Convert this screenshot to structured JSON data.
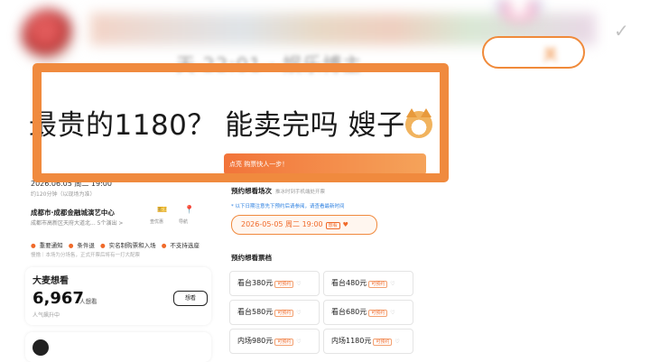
{
  "post": {
    "meta_text": "天 22:01 · 娱乐博主",
    "follow_label": "关",
    "title_text": "最贵的1180？ 能卖完吗 嫂子"
  },
  "left_panel": {
    "date": "2026.06.05 周二 19:00",
    "duration": "约120分钟（以现场为准）",
    "venue": "成都市·成都金融城演艺中心",
    "address": "成都市高新区天府大道北...  5个演出 >",
    "icon_labels": [
      "查优惠",
      "导航"
    ],
    "tags": [
      "重要通知",
      "条件退",
      "实名制购票和入场",
      "不支持选座"
    ],
    "tag_note": "慢撸｜本场为分场售，正式开票后将有一打大配票",
    "want": {
      "title": "大麦想看",
      "count": "6,967",
      "unit": "人想看",
      "sub": "人气飙升中",
      "button_label": "想看"
    }
  },
  "right_panel": {
    "banner_text": "点亮 购票快人一步！",
    "session_title": "预约想看场次",
    "session_note": "推冰时到手机端处开票",
    "note": "* 以下日期注意先下预约后请参阅，请查看最新时间",
    "session": "2026-05-05 周二 19:00",
    "session_tag": "想看",
    "price_title": "预约想看票档",
    "prices": [
      {
        "label": "看台380元",
        "tag": "可预约"
      },
      {
        "label": "看台480元",
        "tag": "可预约"
      },
      {
        "label": "看台580元",
        "tag": "可预约"
      },
      {
        "label": "看台680元",
        "tag": "可预约"
      },
      {
        "label": "内场980元",
        "tag": "可预约"
      },
      {
        "label": "内场1180元",
        "tag": "可预约"
      }
    ]
  }
}
